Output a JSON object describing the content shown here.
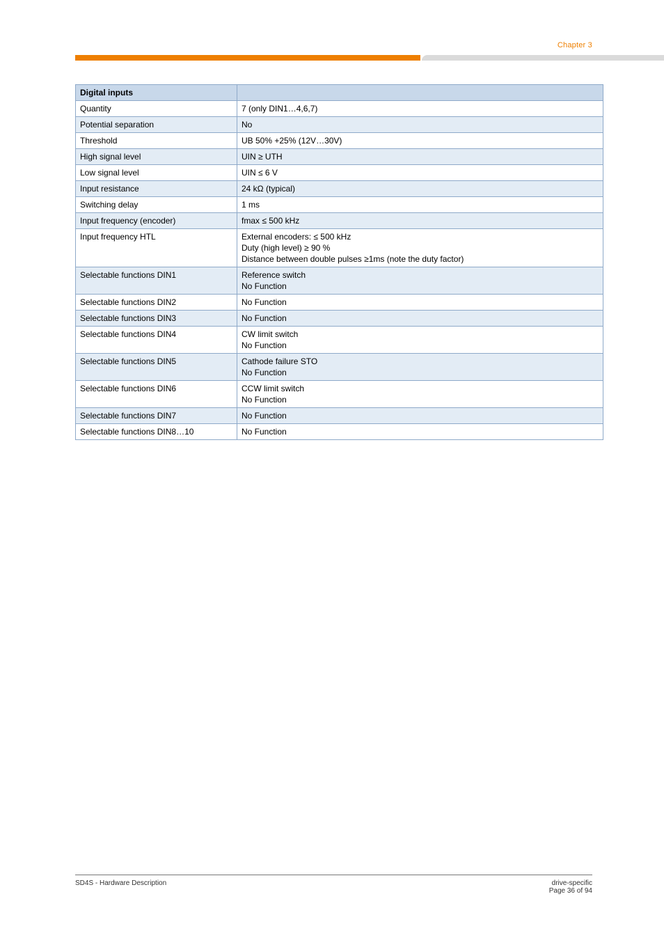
{
  "header": {
    "section_no": "Chapter 3"
  },
  "table": {
    "groupTitle": "Digital inputs",
    "rows": [
      {
        "alt": false,
        "k": "Quantity",
        "v": "7 (only DIN1…4,6,7)"
      },
      {
        "alt": true,
        "k": "Potential separation",
        "v": "No"
      },
      {
        "alt": false,
        "k": "Threshold",
        "v": "UB 50% +25%      (12V…30V)"
      },
      {
        "alt": true,
        "k": "High signal level",
        "v": "UIN ≥ UTH"
      },
      {
        "alt": false,
        "k": "Low signal level",
        "v": "UIN ≤ 6 V"
      },
      {
        "alt": true,
        "k": "Input resistance",
        "v": "24 kΩ (typical)"
      },
      {
        "alt": false,
        "k": "Switching delay",
        "v": "1 ms"
      },
      {
        "alt": true,
        "k": "Input frequency (encoder)",
        "v": "fmax ≤ 500 kHz"
      },
      {
        "alt": false,
        "k": "Input frequency HTL",
        "v": "External encoders: ≤ 500 kHz\nDuty (high level)  ≥ 90 %\nDistance between double pulses ≥1ms   (note the duty factor)"
      },
      {
        "alt": true,
        "k": "Selectable functions DIN1",
        "v": "Reference switch\nNo Function"
      },
      {
        "alt": false,
        "k": "Selectable functions DIN2",
        "v": "No Function"
      },
      {
        "alt": true,
        "k": "Selectable functions DIN3",
        "v": "No Function"
      },
      {
        "alt": false,
        "k": "Selectable functions DIN4",
        "v": "CW limit switch\nNo Function"
      },
      {
        "alt": true,
        "k": "Selectable functions DIN5",
        "v": "Cathode failure STO\nNo Function"
      },
      {
        "alt": false,
        "k": "Selectable functions DIN6",
        "v": "CCW limit switch\nNo Function"
      },
      {
        "alt": true,
        "k": "Selectable functions DIN7",
        "v": "No Function"
      },
      {
        "alt": false,
        "k": "Selectable functions DIN8…10",
        "v": "No Function"
      }
    ]
  },
  "footer": {
    "left": "SD4S - Hardware Description",
    "right_line1": "drive-specific",
    "right_line2": "Page 36 of 94"
  }
}
